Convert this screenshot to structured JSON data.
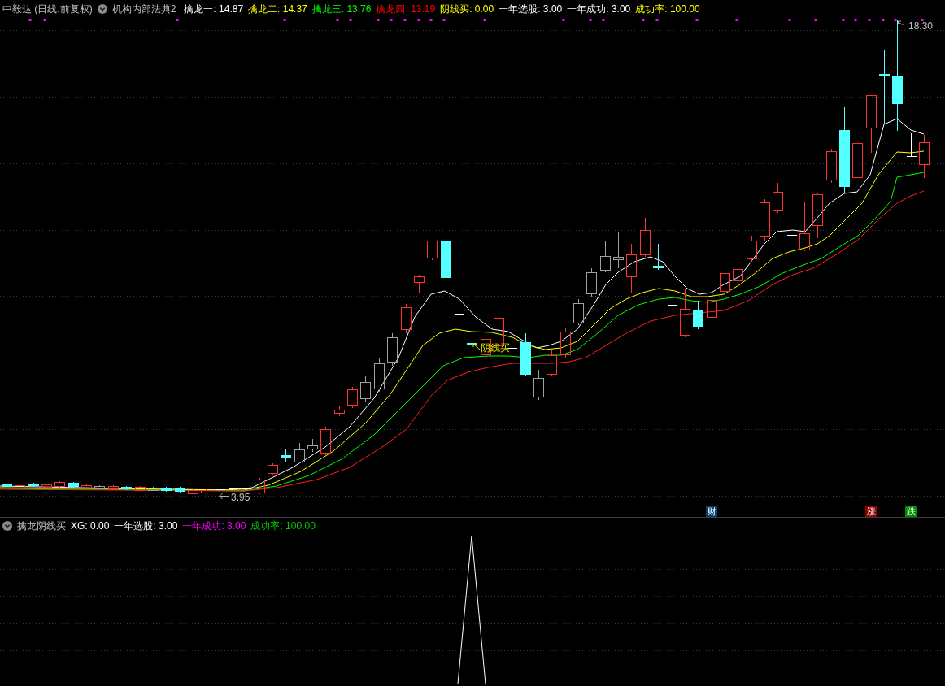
{
  "header": {
    "security": "中毅达 (日线.前复权)",
    "indicator": "机构内部法典2",
    "values": [
      {
        "text": "擒龙一: 14.87",
        "color": "#ffffff"
      },
      {
        "text": "擒龙二: 14.37",
        "color": "#ffff00"
      },
      {
        "text": "擒龙三: 13.76",
        "color": "#00ff00"
      },
      {
        "text": "擒龙四: 13.19",
        "color": "#ff0000"
      },
      {
        "text": "阴线买: 0.00",
        "color": "#ffff00"
      },
      {
        "text": "一年选股: 3.00",
        "color": "#ffffff"
      },
      {
        "text": "一年成功: 3.00",
        "color": "#ffffff"
      },
      {
        "text": "成功率: 100.00",
        "color": "#ffff00"
      }
    ]
  },
  "main_chart": {
    "high_label": "18.30",
    "low_label": "3.95",
    "signal_label": "阴线买",
    "event_badges": [
      {
        "text": "财",
        "color": "#0a3c6e"
      },
      {
        "text": "涨",
        "color": "#8c0000"
      },
      {
        "text": "跌",
        "color": "#008c00"
      }
    ]
  },
  "sub_panel": {
    "indicator": "擒龙阴线买",
    "values": [
      {
        "text": "XG: 0.00",
        "color": "#ffffff"
      },
      {
        "text": "一年选股: 3.00",
        "color": "#ffffff"
      },
      {
        "text": "一年成功: 3.00",
        "color": "#ff00ff"
      },
      {
        "text": "成功率: 100.00",
        "color": "#00cc00"
      }
    ]
  }
}
